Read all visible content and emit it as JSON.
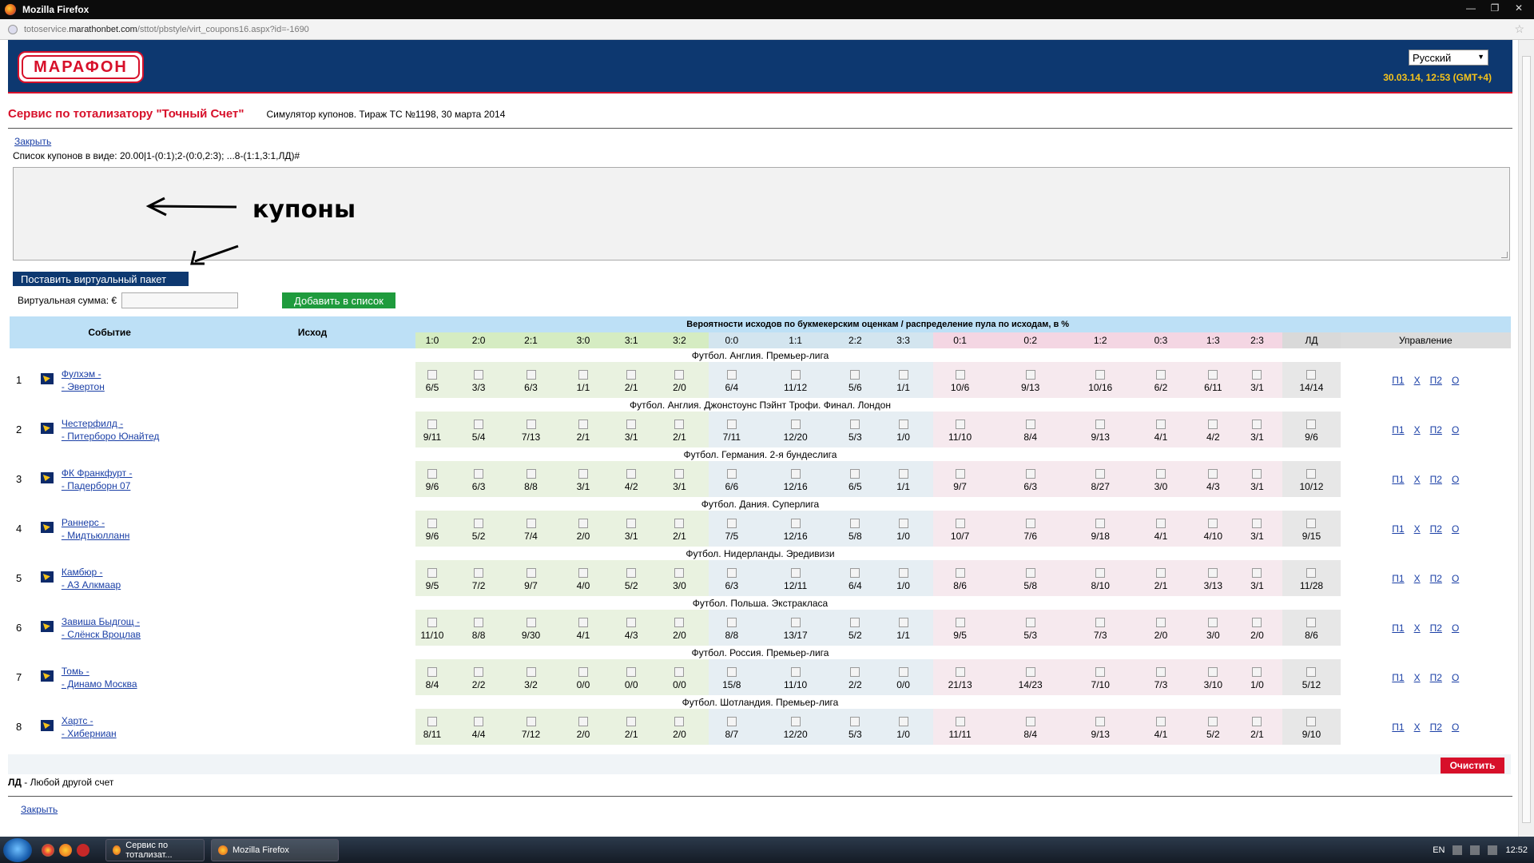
{
  "window": {
    "title": "Mozilla Firefox"
  },
  "browser": {
    "url_prefix": "totoservice.",
    "url_domain": "marathonbet.com",
    "url_path": "/sttot/pbstyle/virt_coupons16.aspx?id=-1690"
  },
  "header": {
    "logo_text": "МАРАФОН",
    "language": "Русский",
    "datetime": "30.03.14,  12:53 (GMT+4)"
  },
  "page": {
    "title": "Сервис по тотализатору \"Точный Счет\"",
    "subtitle": "Симулятор купонов. Тираж ТС №1198, 30 марта 2014",
    "close_label": "Закрыть",
    "list_hint": "Список купонов в виде: 20.00|1-(0:1);2-(0:0,2:3); ...8-(1:1,3:1,ЛД)#",
    "annotation_text": "купоны",
    "virtual_packet_button": "Поставить виртуальный пакет",
    "virtual_sum_label": "Виртуальная сумма: €",
    "add_button": "Добавить в список",
    "clear_button": "Очистить",
    "legend_bold": "ЛД",
    "legend_rest": " - Любой другой счет",
    "close_label_bottom": "Закрыть"
  },
  "table": {
    "col_event": "Событие",
    "col_outcome": "Исход",
    "col_probs": "Вероятности исходов по букмекерским оценкам / распределение пула по исходам, в %",
    "col_manage": "Управление",
    "scores": [
      "1:0",
      "2:0",
      "2:1",
      "3:0",
      "3:1",
      "3:2",
      "0:0",
      "1:1",
      "2:2",
      "3:3",
      "0:1",
      "0:2",
      "1:2",
      "0:3",
      "1:3",
      "2:3",
      "ЛД"
    ],
    "controls": [
      "П1",
      "Х",
      "П2",
      "О"
    ],
    "matches": [
      {
        "league": "Футбол. Англия. Премьер-лига",
        "num": "1",
        "home": "Фулхэм -",
        "away": "- Эвертон",
        "vals": [
          "6/5",
          "3/3",
          "6/3",
          "1/1",
          "2/1",
          "2/0",
          "6/4",
          "11/12",
          "5/6",
          "1/1",
          "10/6",
          "9/13",
          "10/16",
          "6/2",
          "6/11",
          "3/1",
          "14/14"
        ]
      },
      {
        "league": "Футбол. Англия. Джонстоунс Пэйнт Трофи. Финал. Лондон",
        "num": "2",
        "home": "Честерфилд -",
        "away": "- Питерборо Юнайтед",
        "vals": [
          "9/11",
          "5/4",
          "7/13",
          "2/1",
          "3/1",
          "2/1",
          "7/11",
          "12/20",
          "5/3",
          "1/0",
          "11/10",
          "8/4",
          "9/13",
          "4/1",
          "4/2",
          "3/1",
          "9/6"
        ]
      },
      {
        "league": "Футбол. Германия. 2-я бундеслига",
        "num": "3",
        "home": "ФК Франкфурт -",
        "away": "- Падерборн 07",
        "vals": [
          "9/6",
          "6/3",
          "8/8",
          "3/1",
          "4/2",
          "3/1",
          "6/6",
          "12/16",
          "6/5",
          "1/1",
          "9/7",
          "6/3",
          "8/27",
          "3/0",
          "4/3",
          "3/1",
          "10/12"
        ]
      },
      {
        "league": "Футбол. Дания. Суперлига",
        "num": "4",
        "home": "Раннерс -",
        "away": "- Мидтьюлланн",
        "vals": [
          "9/6",
          "5/2",
          "7/4",
          "2/0",
          "3/1",
          "2/1",
          "7/5",
          "12/16",
          "5/8",
          "1/0",
          "10/7",
          "7/6",
          "9/18",
          "4/1",
          "4/10",
          "3/1",
          "9/15"
        ]
      },
      {
        "league": "Футбол. Нидерланды. Эредивизи",
        "num": "5",
        "home": "Камбюр -",
        "away": "- АЗ Алкмаар",
        "vals": [
          "9/5",
          "7/2",
          "9/7",
          "4/0",
          "5/2",
          "3/0",
          "6/3",
          "12/11",
          "6/4",
          "1/0",
          "8/6",
          "5/8",
          "8/10",
          "2/1",
          "3/13",
          "3/1",
          "11/28"
        ]
      },
      {
        "league": "Футбол. Польша. Экстракласа",
        "num": "6",
        "home": "Завиша Быдгощ -",
        "away": "- Слёнск Вроцлав",
        "vals": [
          "11/10",
          "8/8",
          "9/30",
          "4/1",
          "4/3",
          "2/0",
          "8/8",
          "13/17",
          "5/2",
          "1/1",
          "9/5",
          "5/3",
          "7/3",
          "2/0",
          "3/0",
          "2/0",
          "8/6"
        ]
      },
      {
        "league": "Футбол. Россия. Премьер-лига",
        "num": "7",
        "home": "Томь -",
        "away": "- Динамо Москва",
        "vals": [
          "8/4",
          "2/2",
          "3/2",
          "0/0",
          "0/0",
          "0/0",
          "15/8",
          "11/10",
          "2/2",
          "0/0",
          "21/13",
          "14/23",
          "7/10",
          "7/3",
          "3/10",
          "1/0",
          "5/12"
        ]
      },
      {
        "league": "Футбол. Шотландия. Премьер-лига",
        "num": "8",
        "home": "Хартс -",
        "away": "- Хиберниан",
        "vals": [
          "8/11",
          "4/4",
          "7/12",
          "2/0",
          "2/1",
          "2/0",
          "8/7",
          "12/20",
          "5/3",
          "1/0",
          "11/11",
          "8/4",
          "9/13",
          "4/1",
          "5/2",
          "2/1",
          "9/10"
        ]
      }
    ]
  },
  "taskbar": {
    "task1": "Сервис по тотализат...",
    "task2": "Mozilla Firefox",
    "lang": "EN",
    "clock": "12:52"
  }
}
